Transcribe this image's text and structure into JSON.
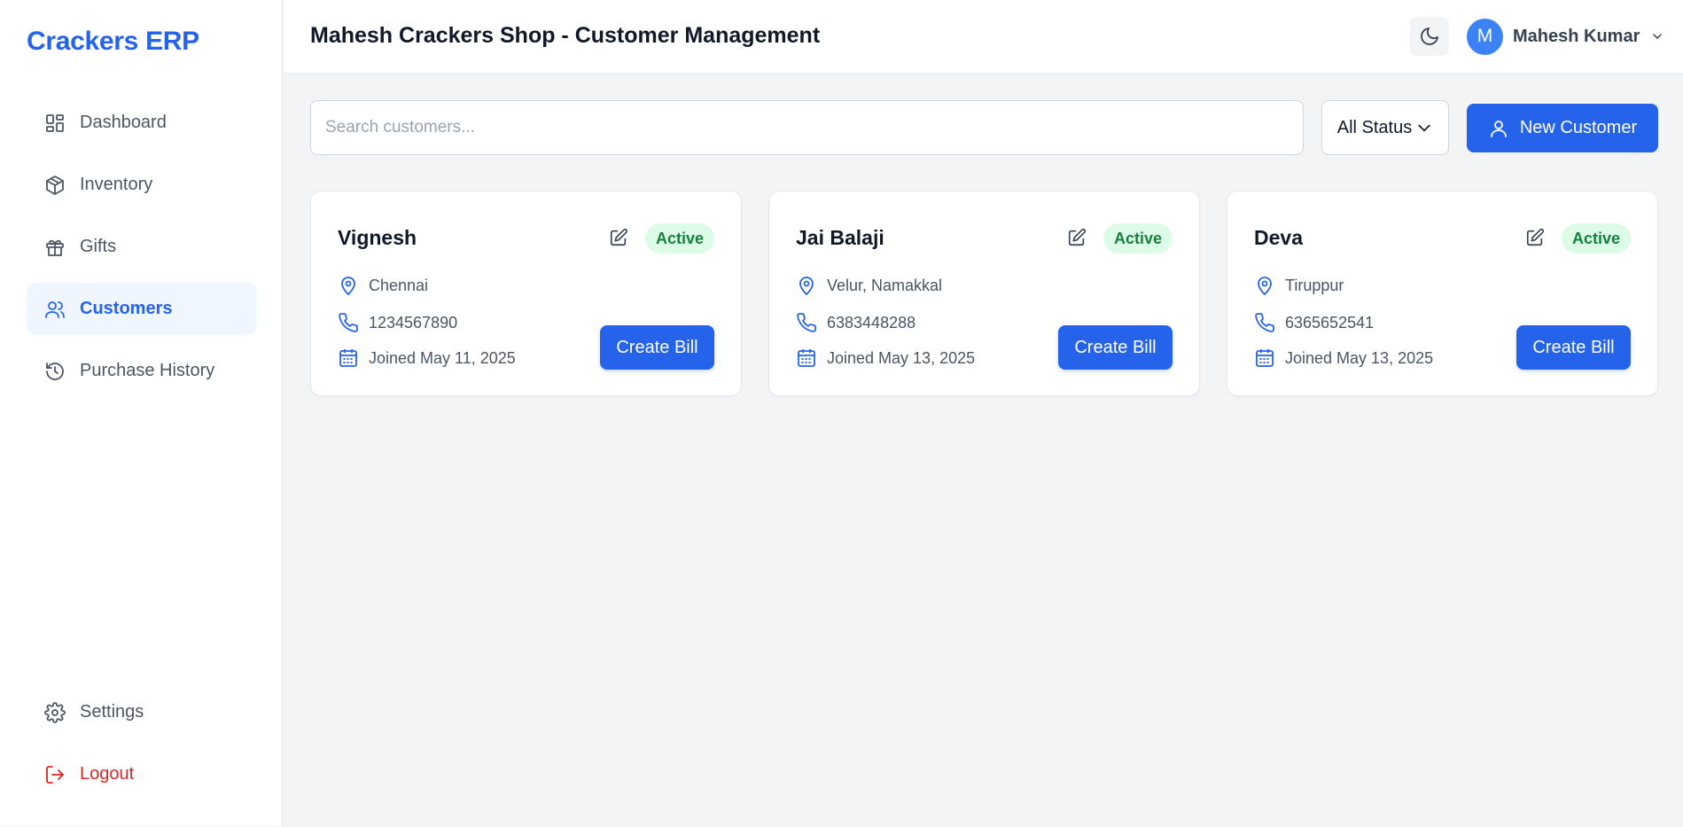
{
  "app": {
    "brand": "Crackers ERP",
    "page_title": "Mahesh Crackers Shop - Customer Management"
  },
  "colors": {
    "accent": "#2563eb",
    "active_badge_bg": "#dcfce7",
    "active_badge_text": "#15803d",
    "logout": "#dc2626"
  },
  "sidebar": {
    "items": [
      {
        "label": "Dashboard",
        "icon": "dashboard-icon"
      },
      {
        "label": "Inventory",
        "icon": "box-icon"
      },
      {
        "label": "Gifts",
        "icon": "gift-icon"
      },
      {
        "label": "Customers",
        "icon": "users-icon",
        "active": true
      },
      {
        "label": "Purchase History",
        "icon": "history-icon"
      }
    ],
    "bottom": [
      {
        "label": "Settings",
        "icon": "gear-icon"
      },
      {
        "label": "Logout",
        "icon": "logout-icon"
      }
    ]
  },
  "header": {
    "theme_icon": "moon-icon",
    "user": {
      "initial": "M",
      "name": "Mahesh Kumar"
    }
  },
  "toolbar": {
    "search_placeholder": "Search customers...",
    "status_filter": "All Status",
    "new_customer_label": "New Customer"
  },
  "customers": [
    {
      "name": "Vignesh",
      "status": "Active",
      "location": "Chennai",
      "phone": "1234567890",
      "joined": "Joined May 11, 2025",
      "action": "Create Bill"
    },
    {
      "name": "Jai Balaji",
      "status": "Active",
      "location": "Velur, Namakkal",
      "phone": "6383448288",
      "joined": "Joined May 13, 2025",
      "action": "Create Bill"
    },
    {
      "name": "Deva",
      "status": "Active",
      "location": "Tiruppur",
      "phone": "6365652541",
      "joined": "Joined May 13, 2025",
      "action": "Create Bill"
    }
  ]
}
